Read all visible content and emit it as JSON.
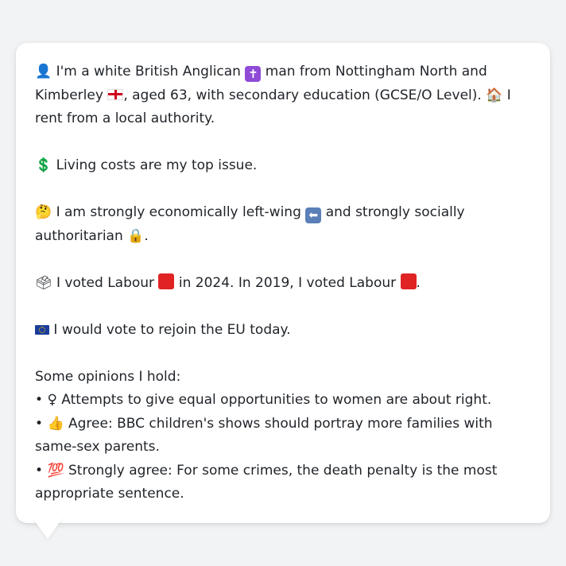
{
  "profile": {
    "p1": {
      "icon": "person-silhouette-icon",
      "part1": "I'm a white British Anglican",
      "icon2": "latin-cross-icon",
      "part2": "man from Nottingham North and Kimberley",
      "icon3": "england-flag-icon",
      "part3": ", aged 63, with secondary education (GCSE/O Level).",
      "icon4": "house-icon",
      "part4": "I rent from a local authority."
    },
    "p2": {
      "icon": "dollar-sign-icon",
      "text": "Living costs are my top issue."
    },
    "p3": {
      "icon": "thinking-face-icon",
      "part1": "I am strongly economically left-wing",
      "icon2": "left-arrow-icon",
      "part2": "and strongly socially authoritarian",
      "icon3": "lock-icon",
      "part3": "."
    },
    "p4": {
      "icon": "ballot-box-icon",
      "part1": "I voted Labour",
      "part2": "in 2024. In 2019, I voted Labour",
      "part3": ".",
      "party_color": "#e02424"
    },
    "p5": {
      "icon": "eu-flag-icon",
      "text": "I would vote to rejoin the EU today."
    },
    "opinions": {
      "heading": "Some opinions I hold:",
      "items": [
        {
          "icon": "female-sign-icon",
          "glyph": "♀",
          "text": "Attempts to give equal opportunities to women are about right."
        },
        {
          "icon": "thumbs-up-icon",
          "glyph": "👍",
          "text": "Agree: BBC children's shows should portray more families with same-sex parents."
        },
        {
          "icon": "hundred-points-icon",
          "glyph": "💯",
          "text": "Strongly agree: For some crimes, the death penalty is the most appropriate sentence."
        }
      ]
    }
  }
}
